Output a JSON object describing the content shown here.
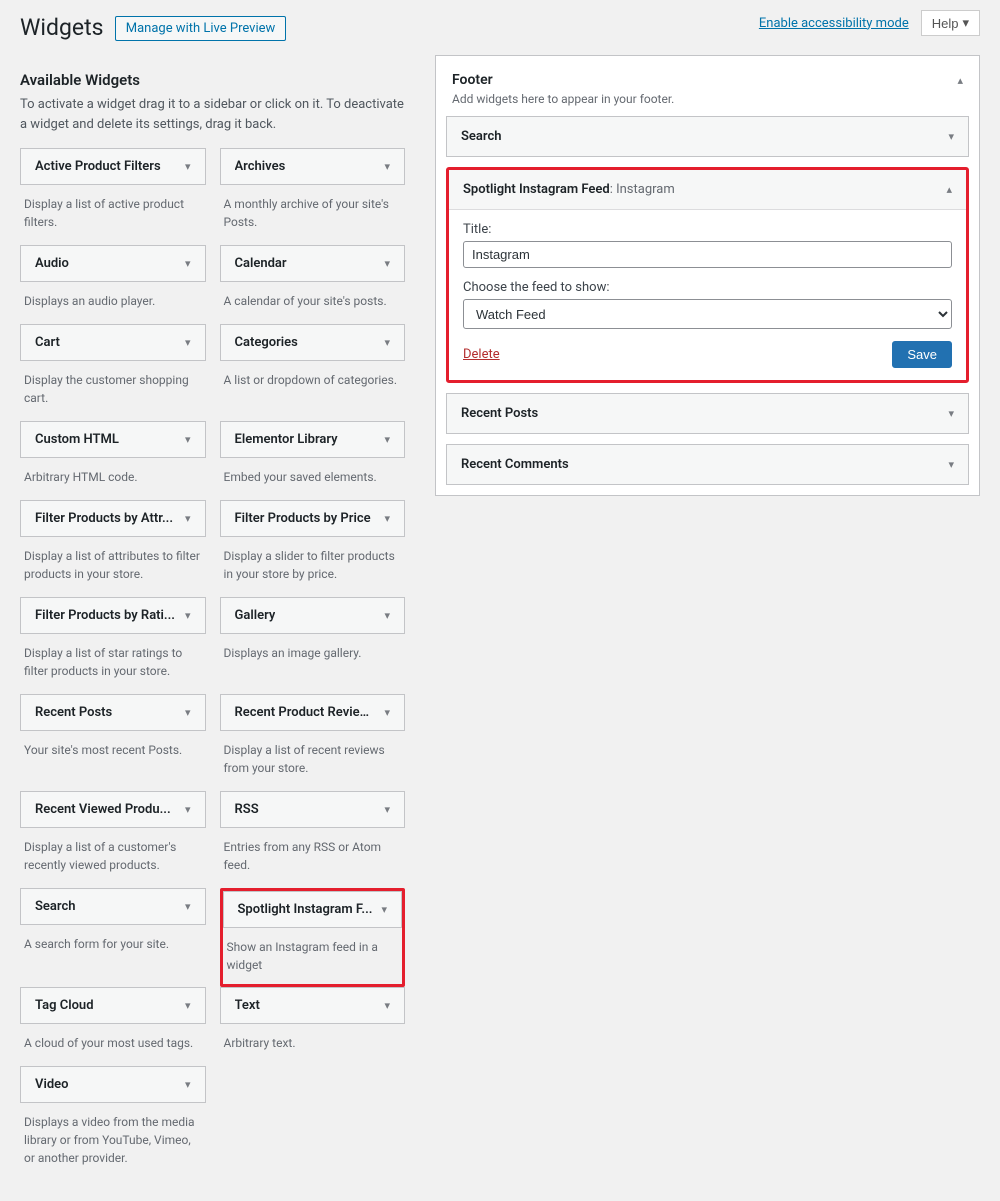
{
  "topbar": {
    "accessibility": "Enable accessibility mode",
    "help": "Help"
  },
  "page": {
    "title": "Widgets",
    "preview_button": "Manage with Live Preview"
  },
  "available": {
    "heading": "Available Widgets",
    "intro": "To activate a widget drag it to a sidebar or click on it. To deactivate a widget and delete its settings, drag it back."
  },
  "widgets": [
    {
      "title": "Active Product Filters",
      "desc": "Display a list of active product filters."
    },
    {
      "title": "Archives",
      "desc": "A monthly archive of your site's Posts."
    },
    {
      "title": "Audio",
      "desc": "Displays an audio player."
    },
    {
      "title": "Calendar",
      "desc": "A calendar of your site's posts."
    },
    {
      "title": "Cart",
      "desc": "Display the customer shopping cart."
    },
    {
      "title": "Categories",
      "desc": "A list or dropdown of categories."
    },
    {
      "title": "Custom HTML",
      "desc": "Arbitrary HTML code."
    },
    {
      "title": "Elementor Library",
      "desc": "Embed your saved elements."
    },
    {
      "title": "Filter Products by Attr...",
      "desc": "Display a list of attributes to filter products in your store."
    },
    {
      "title": "Filter Products by Price",
      "desc": "Display a slider to filter products in your store by price."
    },
    {
      "title": "Filter Products by Rati...",
      "desc": "Display a list of star ratings to filter products in your store."
    },
    {
      "title": "Gallery",
      "desc": "Displays an image gallery."
    },
    {
      "title": "Recent Posts",
      "desc": "Your site's most recent Posts."
    },
    {
      "title": "Recent Product Reviews",
      "desc": "Display a list of recent reviews from your store."
    },
    {
      "title": "Recent Viewed Produ...",
      "desc": "Display a list of a customer's recently viewed products."
    },
    {
      "title": "RSS",
      "desc": "Entries from any RSS or Atom feed."
    },
    {
      "title": "Search",
      "desc": "A search form for your site."
    },
    {
      "title": "Spotlight Instagram F...",
      "desc": "Show an Instagram feed in a widget",
      "highlight": true
    },
    {
      "title": "Tag Cloud",
      "desc": "A cloud of your most used tags."
    },
    {
      "title": "Text",
      "desc": "Arbitrary text."
    },
    {
      "title": "Video",
      "desc": "Displays a video from the media library or from YouTube, Vimeo, or another provider."
    }
  ],
  "footer_area": {
    "title": "Footer",
    "desc": "Add widgets here to appear in your footer.",
    "items": {
      "search": "Search",
      "recent_posts": "Recent Posts",
      "recent_comments": "Recent Comments"
    }
  },
  "open_widget": {
    "name": "Spotlight Instagram Feed",
    "suffix": ": Instagram",
    "title_label": "Title:",
    "title_value": "Instagram",
    "feed_label": "Choose the feed to show:",
    "feed_value": "Watch Feed",
    "delete": "Delete",
    "save": "Save"
  }
}
